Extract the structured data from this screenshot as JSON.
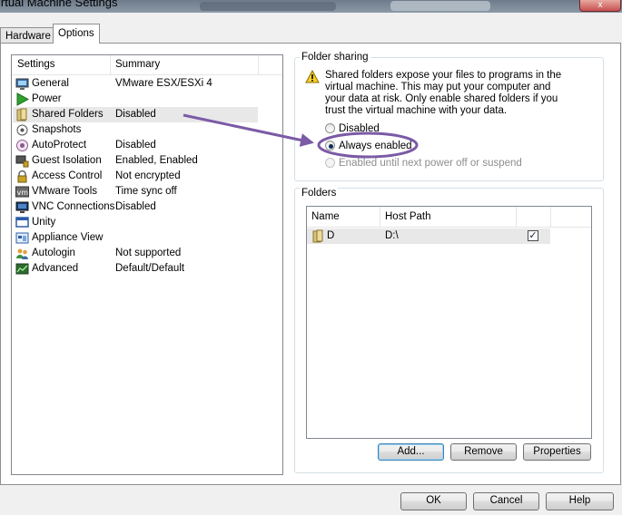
{
  "window": {
    "title": "irtual Machine Settings",
    "close_symbol": "x"
  },
  "tabs": [
    {
      "label": "Hardware"
    },
    {
      "label": "Options",
      "active": true
    }
  ],
  "settings_list": {
    "headers": {
      "settings": "Settings",
      "summary": "Summary"
    },
    "items": [
      {
        "name": "General",
        "summary": "VMware ESX/ESXi 4",
        "icon": "monitor-icon"
      },
      {
        "name": "Power",
        "summary": "",
        "icon": "play-icon"
      },
      {
        "name": "Shared Folders",
        "summary": "Disabled",
        "icon": "folder-icon",
        "selected": true
      },
      {
        "name": "Snapshots",
        "summary": "",
        "icon": "snapshot-icon"
      },
      {
        "name": "AutoProtect",
        "summary": "Disabled",
        "icon": "autoprotect-icon"
      },
      {
        "name": "Guest Isolation",
        "summary": "Enabled, Enabled",
        "icon": "computer-lock-icon"
      },
      {
        "name": "Access Control",
        "summary": "Not encrypted",
        "icon": "lock-icon"
      },
      {
        "name": "VMware Tools",
        "summary": "Time sync off",
        "icon": "vm-icon"
      },
      {
        "name": "VNC Connections",
        "summary": "Disabled",
        "icon": "vnc-icon"
      },
      {
        "name": "Unity",
        "summary": "",
        "icon": "unity-icon"
      },
      {
        "name": "Appliance View",
        "summary": "",
        "icon": "appliance-icon"
      },
      {
        "name": "Autologin",
        "summary": "Not supported",
        "icon": "users-icon"
      },
      {
        "name": "Advanced",
        "summary": "Default/Default",
        "icon": "chart-icon"
      }
    ]
  },
  "folder_sharing": {
    "label": "Folder sharing",
    "warning_icon": "warning-icon",
    "warning": "Shared folders expose your files to programs in the virtual machine. This may put your computer and your data at risk. Only enable shared folders if you trust the virtual machine with your data.",
    "options": [
      {
        "label": "Disabled",
        "selected": false,
        "enabled": true
      },
      {
        "label": "Always enabled",
        "selected": true,
        "enabled": true
      },
      {
        "label": "Enabled until next power off or suspend",
        "selected": false,
        "enabled": false
      }
    ]
  },
  "folders": {
    "label": "Folders",
    "columns": [
      "Name",
      "Host Path"
    ],
    "rows": [
      {
        "name": "D",
        "host_path": "D:\\",
        "enabled": true,
        "check": "✓"
      }
    ],
    "buttons": {
      "add": "Add...",
      "remove": "Remove",
      "properties": "Properties"
    }
  },
  "dialog_buttons": {
    "ok": "OK",
    "cancel": "Cancel",
    "help": "Help"
  },
  "annotation": {
    "color": "#7b5aa6"
  }
}
